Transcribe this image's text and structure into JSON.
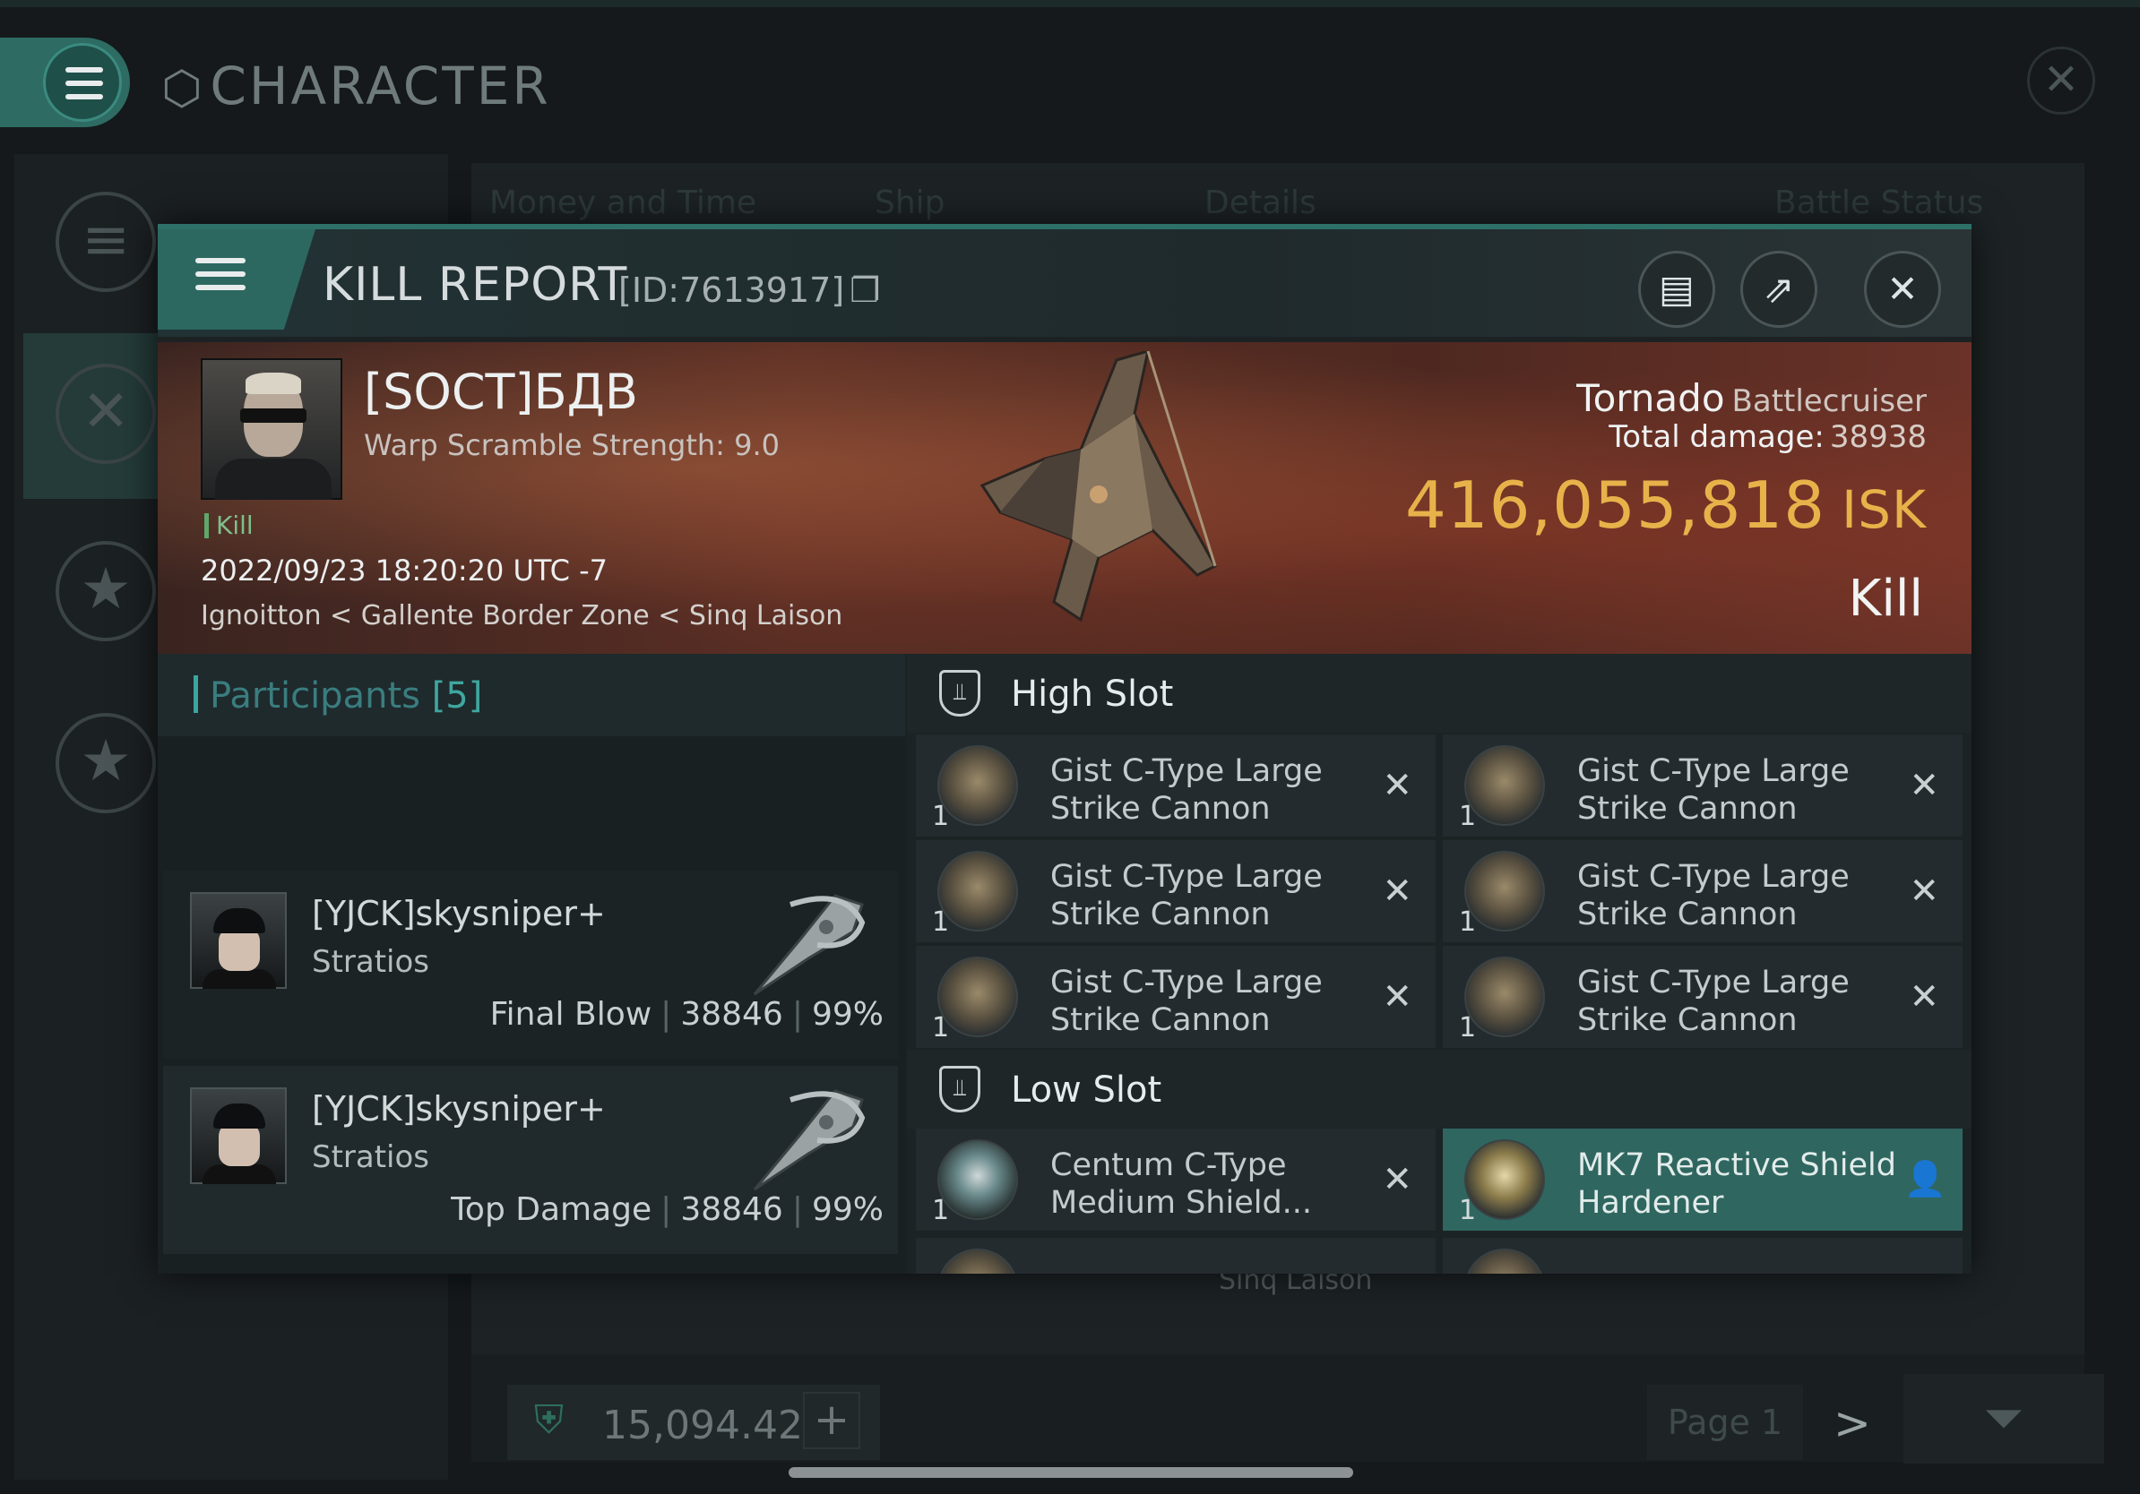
{
  "app": {
    "screen_title": "CHARACTER",
    "bg_tabs": [
      "Money and Time",
      "Ship",
      "Details",
      "Battle Status"
    ],
    "bg_location": "Sinq Laison",
    "wallet_value": "15,094.42",
    "page_label": "Page 1"
  },
  "report": {
    "title": "KILL REPORT",
    "id": "[ID:7613917]",
    "victim": {
      "name": "[SOCT]БДВ",
      "subtitle": "Warp Scramble Strength: 9.0",
      "tag": "Kill",
      "datetime": "2022/09/23 18:20:20 UTC -7",
      "location": "Ignoitton < Gallente Border Zone < Sinq Laison"
    },
    "ship": {
      "name": "Tornado",
      "class": "Battlecruiser",
      "total_damage_label": "Total damage:",
      "total_damage": "38938",
      "value": "416,055,818",
      "currency": "ISK",
      "result": "Kill"
    },
    "participants": {
      "label": "Participants",
      "count": "[5]",
      "items": [
        {
          "name": "[YJCK]skysniper+",
          "ship": "Stratios",
          "role": "Final Blow",
          "damage": "38846",
          "percent": "99%"
        },
        {
          "name": "[YJCK]skysniper+",
          "ship": "Stratios",
          "role": "Top Damage",
          "damage": "38846",
          "percent": "99%"
        }
      ]
    },
    "fitting": {
      "high_slot_label": "High Slot",
      "low_slot_label": "Low Slot",
      "high": [
        {
          "name": "Gist C-Type Large Strike Cannon",
          "qty": "1"
        },
        {
          "name": "Gist C-Type Large Strike Cannon",
          "qty": "1"
        },
        {
          "name": "Gist C-Type Large Strike Cannon",
          "qty": "1"
        },
        {
          "name": "Gist C-Type Large Strike Cannon",
          "qty": "1"
        },
        {
          "name": "Gist C-Type Large Strike Cannon",
          "qty": "1"
        },
        {
          "name": "Gist C-Type Large Strike Cannon",
          "qty": "1"
        }
      ],
      "low": [
        {
          "name": "Centum C-Type Medium Shield...",
          "qty": "1"
        },
        {
          "name": "MK7 Reactive Shield Hardener",
          "qty": "1"
        }
      ]
    }
  },
  "colors": {
    "accent": "#2d7068",
    "isk": "#e8b24a",
    "kill_tag": "#7fbf8a",
    "highlight_row": "#2f6660"
  }
}
